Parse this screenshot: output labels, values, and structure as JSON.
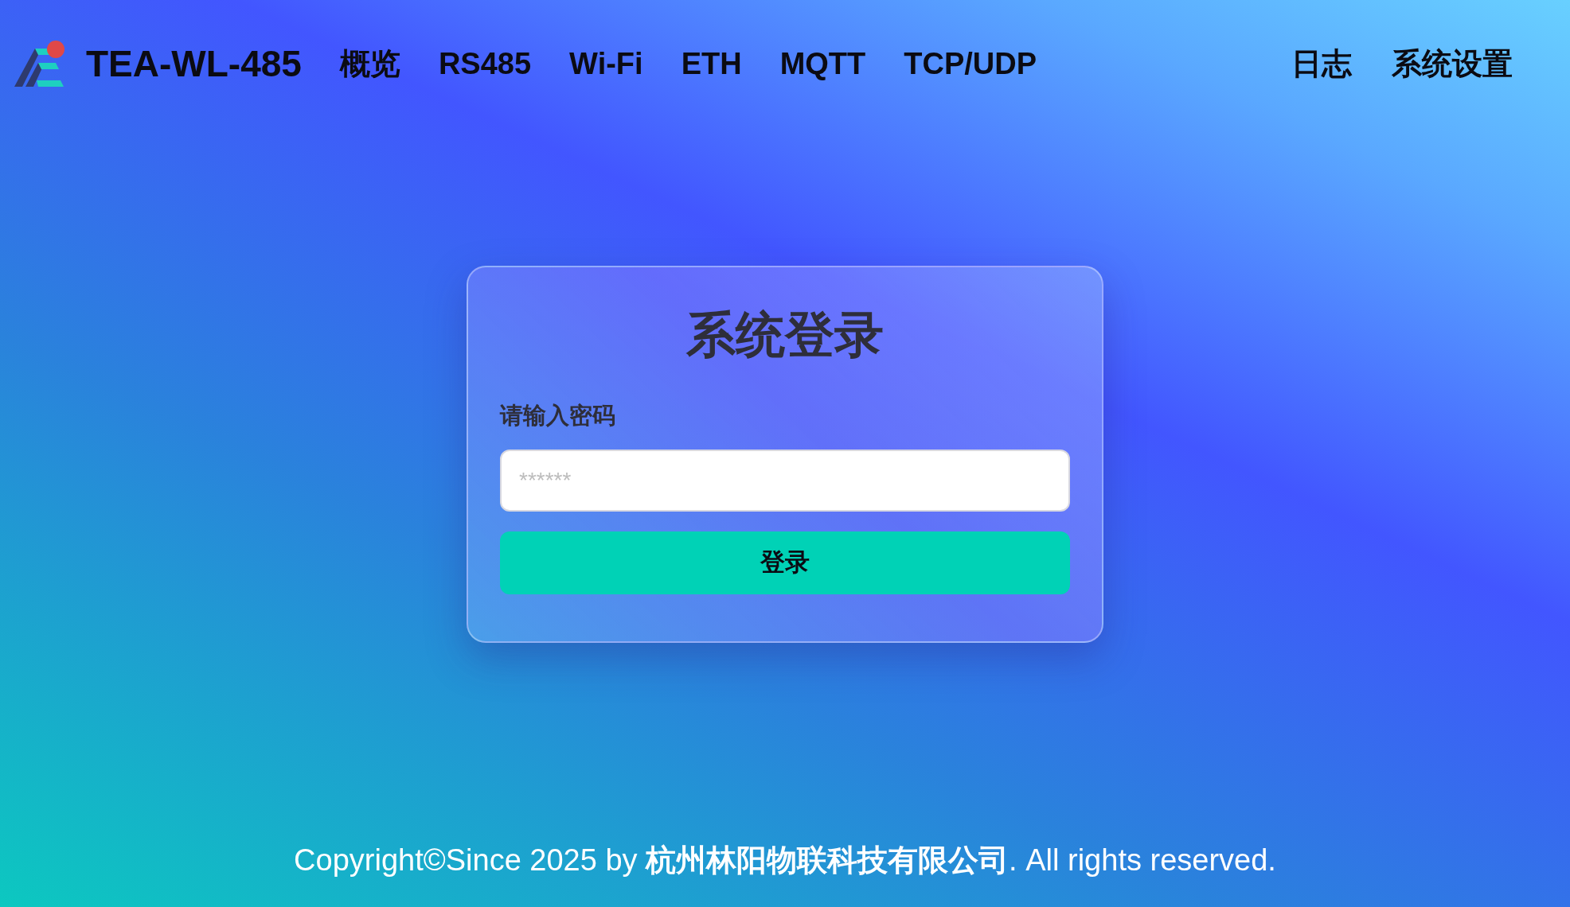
{
  "header": {
    "brand": "TEA-WL-485",
    "nav_left": [
      "概览",
      "RS485",
      "Wi-Fi",
      "ETH",
      "MQTT",
      "TCP/UDP"
    ],
    "nav_right": [
      "日志",
      "系统设置"
    ]
  },
  "login": {
    "title": "系统登录",
    "label": "请输入密码",
    "password": {
      "placeholder": "******"
    },
    "button": "登录"
  },
  "footer": "Copyright©Since 2025 by **杭州林阳物联科技有限公司**. All rights reserved."
}
